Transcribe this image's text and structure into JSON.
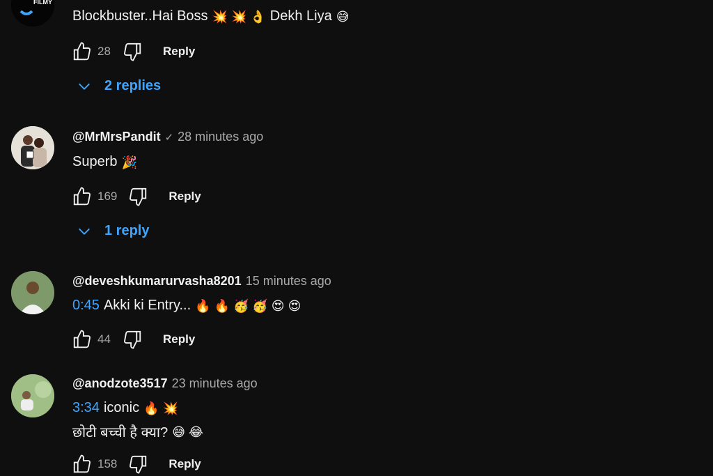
{
  "colors": {
    "background": "#0f0f0f",
    "link": "#3ea6ff",
    "muted": "#aaaaaa",
    "text": "#f1f1f1"
  },
  "comments": [
    {
      "avatar_icon": "filmy-eyes-logo",
      "avatar_text": "FILMY EYES",
      "text": "Blockbuster..Hai Boss",
      "emojis": "💥 💥 👌",
      "text2": "Dekh Liya",
      "emoji2": "😅",
      "likes": "28",
      "reply_label": "Reply",
      "replies_label": "2 replies"
    },
    {
      "author": "@MrMrsPandit",
      "verified": "✓",
      "time": "28 minutes ago",
      "text": "Superb",
      "emojis": "🎉",
      "likes": "169",
      "reply_label": "Reply",
      "replies_label": "1 reply"
    },
    {
      "author": "@deveshkumarurvasha8201",
      "time": "15 minutes ago",
      "timestamp": "0:45",
      "text": "Akki ki Entry...",
      "emojis": "🔥 🔥 🥳 🥳 😍 😍",
      "likes": "44",
      "reply_label": "Reply"
    },
    {
      "author": "@anodzote3517",
      "time": "23 minutes ago",
      "timestamp": "3:34",
      "text": "iconic",
      "emojis": "🔥 💥",
      "text2": "छोटी बच्ची है क्या?",
      "emoji2": "😅 😂",
      "likes": "158",
      "reply_label": "Reply"
    }
  ]
}
